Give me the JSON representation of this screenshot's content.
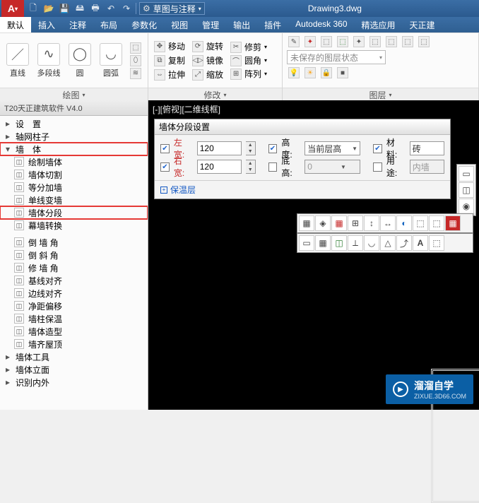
{
  "title": {
    "filename": "Drawing3.dwg"
  },
  "qat": {
    "combo": "草图与注释"
  },
  "tabs": [
    "默认",
    "插入",
    "注释",
    "布局",
    "参数化",
    "视图",
    "管理",
    "输出",
    "插件",
    "Autodesk 360",
    "精选应用",
    "天正建"
  ],
  "activeTab": 0,
  "panel1": {
    "items": [
      "直线",
      "多段线",
      "圆",
      "圆弧"
    ],
    "title": "绘图"
  },
  "panel2": {
    "rows": [
      {
        "a": "移动",
        "b": "旋转",
        "c": "修剪"
      },
      {
        "a": "复制",
        "b": "镜像",
        "c": "圆角"
      },
      {
        "a": "拉伸",
        "b": "缩放",
        "c": "阵列"
      }
    ],
    "title": "修改"
  },
  "panel3": {
    "combo": "未保存的图层状态",
    "title": "图层"
  },
  "side": {
    "title": "T20天正建筑软件 V4.0",
    "items": [
      {
        "label": "设　置",
        "kind": "branch"
      },
      {
        "label": "轴网柱子",
        "kind": "branch"
      },
      {
        "label": "墙　体",
        "kind": "branch",
        "highlight": true
      },
      {
        "label": "绘制墙体",
        "kind": "leaf"
      },
      {
        "label": "墙体切割",
        "kind": "leaf"
      },
      {
        "label": "等分加墙",
        "kind": "leaf"
      },
      {
        "label": "单线变墙",
        "kind": "leaf"
      },
      {
        "label": "墙体分段",
        "kind": "leaf",
        "highlight": true
      },
      {
        "label": "幕墙转换",
        "kind": "leaf"
      },
      {
        "label": "倒 墙 角",
        "kind": "leaf",
        "gap": true
      },
      {
        "label": "倒 斜 角",
        "kind": "leaf"
      },
      {
        "label": "修 墙 角",
        "kind": "leaf"
      },
      {
        "label": "基线对齐",
        "kind": "leaf"
      },
      {
        "label": "边线对齐",
        "kind": "leaf"
      },
      {
        "label": "净距偏移",
        "kind": "leaf"
      },
      {
        "label": "墙柱保温",
        "kind": "leaf"
      },
      {
        "label": "墙体造型",
        "kind": "leaf"
      },
      {
        "label": "墙齐屋顶",
        "kind": "leaf"
      },
      {
        "label": "墙体工具",
        "kind": "branch"
      },
      {
        "label": "墙体立面",
        "kind": "branch"
      },
      {
        "label": "识别内外",
        "kind": "branch"
      }
    ]
  },
  "canvas": {
    "viewlabel": "[-][俯视][二维线框]"
  },
  "dlg": {
    "title": "墙体分段设置",
    "leftW": {
      "label": "左宽:",
      "value": "120",
      "checked": true
    },
    "rightW": {
      "label": "右宽:",
      "value": "120",
      "checked": true
    },
    "height": {
      "label": "高度:",
      "value": "当前层高",
      "checked": true
    },
    "bottom": {
      "label": "底高:",
      "value": "0",
      "checked": false
    },
    "material": {
      "label": "材料:",
      "value": "砖",
      "checked": true
    },
    "usage": {
      "label": "用途:",
      "value": "内墙",
      "checked": false
    },
    "insul": "保温层"
  },
  "watermark": {
    "t1": "溜溜自学",
    "t2": "ZIXUE.3D66.COM"
  }
}
